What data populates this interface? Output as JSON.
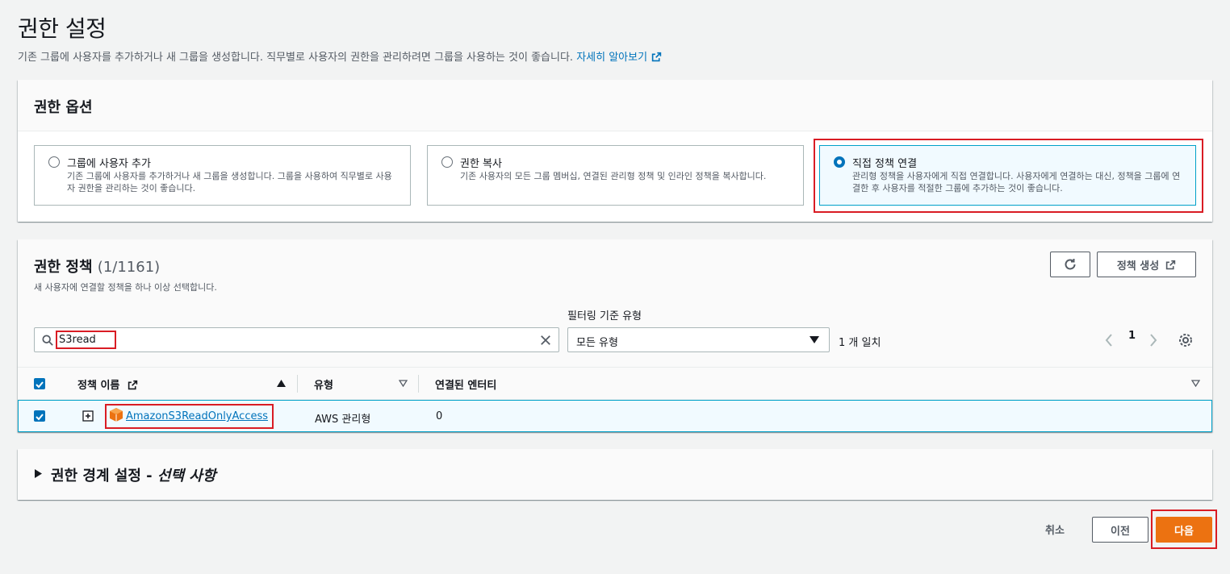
{
  "header": {
    "title": "권한 설정",
    "description": "기존 그룹에 사용자를 추가하거나 새 그룹을 생성합니다. 직무별로 사용자의 권한을 관리하려면 그룹을 사용하는 것이 좋습니다.",
    "learn_more": "자세히 알아보기"
  },
  "options": {
    "title": "권한 옵션",
    "tiles": [
      {
        "label": "그룹에 사용자 추가",
        "desc": "기존 그룹에 사용자를 추가하거나 새 그룹을 생성합니다. 그룹을 사용하여 직무별로 사용자 권한을 관리하는 것이 좋습니다.",
        "selected": false
      },
      {
        "label": "권한 복사",
        "desc": "기존 사용자의 모든 그룹 멤버십, 연결된 관리형 정책 및 인라인 정책을 복사합니다.",
        "selected": false
      },
      {
        "label": "직접 정책 연결",
        "desc": "관리형 정책을 사용자에게 직접 연결합니다. 사용자에게 연결하는 대신, 정책을 그룹에 연결한 후 사용자를 적절한 그룹에 추가하는 것이 좋습니다.",
        "selected": true
      }
    ]
  },
  "policies": {
    "title": "권한 정책",
    "count": "(1/1161)",
    "description": "새 사용자에 연결할 정책을 하나 이상 선택합니다.",
    "create_button": "정책 생성",
    "search_value": "S3read",
    "filter_label": "필터링 기준 유형",
    "filter_value": "모든 유형",
    "matches": "1 개 일치",
    "page": "1",
    "columns": [
      "정책 이름",
      "유형",
      "연결된 엔터티"
    ],
    "rows": [
      {
        "name": "AmazonS3ReadOnlyAccess",
        "type": "AWS 관리형",
        "entities": "0"
      }
    ]
  },
  "boundary": {
    "title_main": "권한 경계 설정 - ",
    "title_em": "선택 사항"
  },
  "footer": {
    "cancel": "취소",
    "previous": "이전",
    "next": "다음"
  },
  "colors": {
    "accent": "#0073bb",
    "primary_button": "#ec7211",
    "highlight": "#d91c24"
  }
}
